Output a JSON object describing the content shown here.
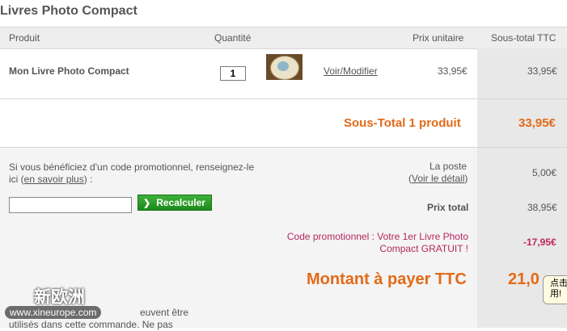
{
  "page_title": "Livres Photo Compact",
  "table": {
    "headers": {
      "product": "Produit",
      "quantity": "Quantité",
      "unit_price": "Prix unitaire",
      "subtotal": "Sous-total TTC"
    },
    "item": {
      "name": "Mon Livre Photo Compact",
      "quantity": "1",
      "link": "Voir/Modifier",
      "unit_price": "33,95€",
      "subtotal": "33,95€"
    },
    "products_subtotal": {
      "label": "Sous-Total 1 produit",
      "value": "33,95€"
    }
  },
  "promo": {
    "text_before": "Si vous bénéficiez d'un code promotionnel, renseignez-le ici (",
    "link": "en savoir plus",
    "text_after": ") :",
    "input_value": "",
    "button_label": "Recalculer"
  },
  "totals": {
    "shipping_label": "La poste",
    "shipping_detail_prefix": "(",
    "shipping_detail_link": "Voir le détail",
    "shipping_detail_suffix": ")",
    "shipping_value": "5,00€",
    "total_label": "Prix total",
    "total_value": "38,95€",
    "promo_code_line1": "Code promotionnel : Votre 1er Livre Photo",
    "promo_code_line2": "Compact GRATUIT !",
    "promo_code_value": "-17,95€",
    "amount_label": "Montant à payer TTC",
    "amount_value": "21,0"
  },
  "bottom_text": {
    "line1": "euvent être",
    "line2": "utilisés dans cette commande. Ne pas"
  },
  "overlay": {
    "line1": "点击",
    "line2": "用!"
  },
  "watermark": {
    "title": "新欧洲",
    "url": "www.xineurope.com"
  },
  "colors": {
    "accent_orange": "#e36a17",
    "promo_pink": "#b5275d",
    "button_green": "#2a9e27"
  }
}
